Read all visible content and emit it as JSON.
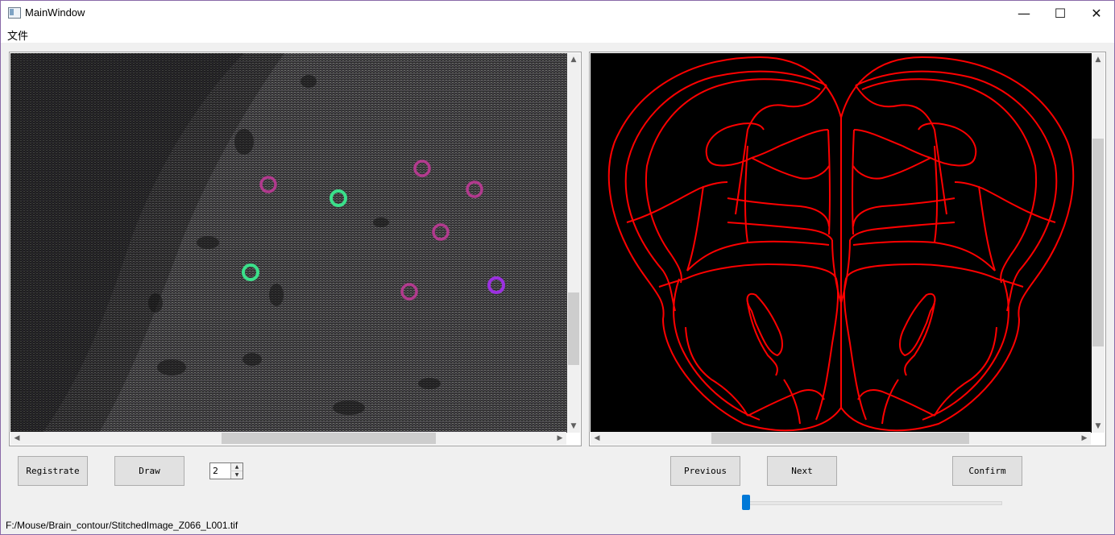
{
  "window": {
    "title": "MainWindow",
    "minimize_glyph": "—",
    "maximize_glyph": "☐",
    "close_glyph": "✕"
  },
  "menu": {
    "items": [
      "文件"
    ]
  },
  "left_view": {
    "content": "stitched-image-grayscale-fluorescence",
    "markers": [
      {
        "color": "#b23a8e"
      },
      {
        "color": "#b23a8e"
      },
      {
        "color": "#b23a8e"
      },
      {
        "color": "#b23a8e"
      },
      {
        "color": "#b23a8e"
      },
      {
        "color": "#3ae08a"
      },
      {
        "color": "#3ae08a"
      },
      {
        "color": "#9b30e0"
      }
    ]
  },
  "right_view": {
    "content": "brain-atlas-contour",
    "contour_color": "#ff0000",
    "background": "#000000"
  },
  "controls": {
    "registrate_label": "Registrate",
    "draw_label": "Draw",
    "spin_value": "2",
    "previous_label": "Previous",
    "next_label": "Next",
    "confirm_label": "Confirm",
    "slider_value": 0
  },
  "status": {
    "file_path": "F:/Mouse/Brain_contour/StitchedImage_Z066_L001.tif"
  },
  "icons": {
    "scroll_up": "▲",
    "scroll_down": "▼",
    "scroll_left": "◀",
    "scroll_right": "▶"
  }
}
